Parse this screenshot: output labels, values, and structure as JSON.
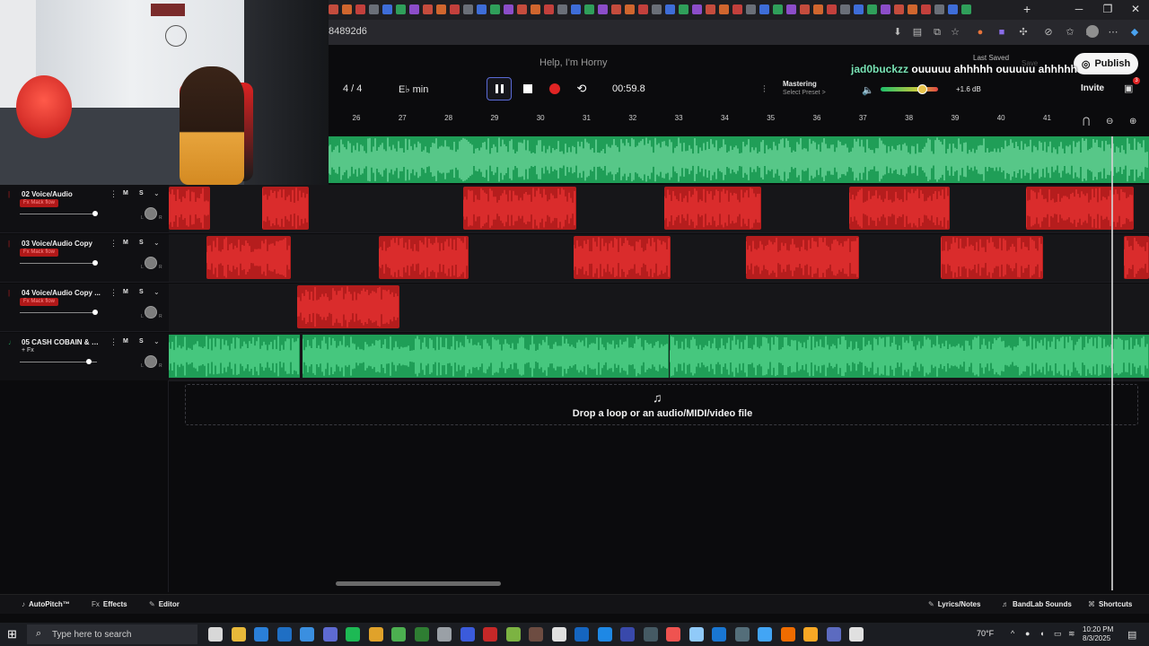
{
  "browser": {
    "url_fragment": "84892d6",
    "new_tab": "+",
    "window_controls": {
      "minimize": "─",
      "maximize": "❐",
      "close": "✕"
    }
  },
  "header": {
    "song_title": "Help, I'm Horny",
    "time_signature": "4 / 4",
    "key": "E♭ min",
    "time": "00:59.8",
    "mastering_label": "Mastering",
    "mastering_preset": "Select Preset >",
    "db_value": "+1.6 dB",
    "volume_level": 0.72,
    "last_saved": "Last Saved",
    "save_label": "Save",
    "publish_label": "Publish",
    "invite_label": "Invite",
    "notification_count": "3"
  },
  "chat": {
    "user": "jad0buckzz",
    "message": "ouuuuu ahhhhh ouuuuu ahhhhh"
  },
  "ruler": {
    "bars": [
      "26",
      "27",
      "28",
      "29",
      "30",
      "31",
      "32",
      "33",
      "34",
      "35",
      "36",
      "37",
      "38",
      "39",
      "40",
      "41"
    ]
  },
  "tracks": [
    {
      "number": "02",
      "name": "Voice/Audio",
      "fx": "Fx Mack flow",
      "fx_red": true,
      "color": "#b51d1d",
      "volume_pos": 0.98,
      "clips": [
        [
          0,
          46
        ],
        [
          104,
          52
        ],
        [
          328,
          126
        ],
        [
          552,
          108
        ],
        [
          758,
          112
        ],
        [
          955,
          120
        ]
      ]
    },
    {
      "number": "03",
      "name": "Voice/Audio Copy",
      "fx": "Fx Mack flow",
      "fx_red": true,
      "color": "#b51d1d",
      "volume_pos": 0.98,
      "clips": [
        [
          42,
          94
        ],
        [
          234,
          100
        ],
        [
          451,
          108
        ],
        [
          643,
          126
        ],
        [
          860,
          114
        ],
        [
          1064,
          28
        ]
      ]
    },
    {
      "number": "04",
      "name": "Voice/Audio Copy ...",
      "fx": "Fx Mack flow",
      "fx_red": true,
      "color": "#b51d1d",
      "volume_pos": 0.98,
      "clips": [
        [
          143,
          114
        ]
      ]
    },
    {
      "number": "05",
      "name": "CASH COBAIN & C...",
      "fx": "+ Fx",
      "fx_red": false,
      "color": "#1f9e57",
      "volume_pos": 0.89,
      "clips": [
        [
          0,
          146
        ],
        [
          149,
          408
        ],
        [
          558,
          534
        ]
      ]
    }
  ],
  "dropzone": {
    "text": "Drop a loop or an audio/MIDI/video file"
  },
  "bottom_bar": {
    "autopitch": "AutoPitch™",
    "effects": "Effects",
    "editor": "Editor",
    "lyrics": "Lyrics/Notes",
    "bandlab_sounds": "BandLab Sounds",
    "shortcuts": "Shortcuts"
  },
  "taskbar": {
    "search_placeholder": "Type here to search",
    "weather": "70°F",
    "time": "10:20 PM",
    "date": "8/3/2025"
  }
}
